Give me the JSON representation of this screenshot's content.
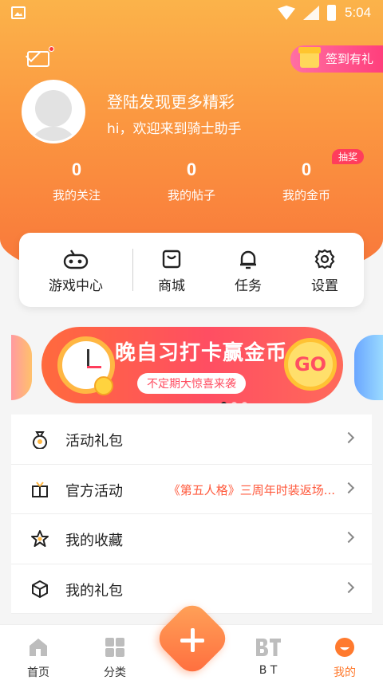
{
  "status_bar": {
    "time": "5:04"
  },
  "header": {
    "signin_label": "签到有礼",
    "login_title": "登陆发现更多精彩",
    "login_subtitle": "hi，欢迎来到骑士助手",
    "lottery_badge": "抽奖"
  },
  "stats": [
    {
      "value": "0",
      "label": "我的关注"
    },
    {
      "value": "0",
      "label": "我的帖子"
    },
    {
      "value": "0",
      "label": "我的金币"
    }
  ],
  "quick_menu": [
    {
      "label": "游戏中心",
      "icon": "gamepad-icon"
    },
    {
      "label": "商城",
      "icon": "shopping-bag-icon"
    },
    {
      "label": "任务",
      "icon": "bell-icon"
    },
    {
      "label": "设置",
      "icon": "gear-icon"
    }
  ],
  "banner": {
    "title": "晚自习打卡赢金币",
    "subtitle": "不定期大惊喜来袭",
    "go_label": "GO",
    "active_dot": 0
  },
  "list": [
    {
      "label": "活动礼包",
      "value": "",
      "icon": "money-bag-icon"
    },
    {
      "label": "官方活动",
      "value": "《第五人格》三周年时装返场...",
      "icon": "gift-box-icon"
    },
    {
      "label": "我的收藏",
      "value": "",
      "icon": "star-icon"
    },
    {
      "label": "我的礼包",
      "value": "",
      "icon": "package-icon"
    }
  ],
  "tabbar": [
    {
      "label": "首页",
      "icon": "home-icon"
    },
    {
      "label": "分类",
      "icon": "grid-icon"
    },
    {
      "label": "B T",
      "icon": "bt-icon"
    },
    {
      "label": "我的",
      "icon": "profile-icon"
    }
  ],
  "colors": {
    "accent": "#fb9540",
    "active_tab": "#ff7a2e",
    "link_text": "#ff5a3d"
  }
}
